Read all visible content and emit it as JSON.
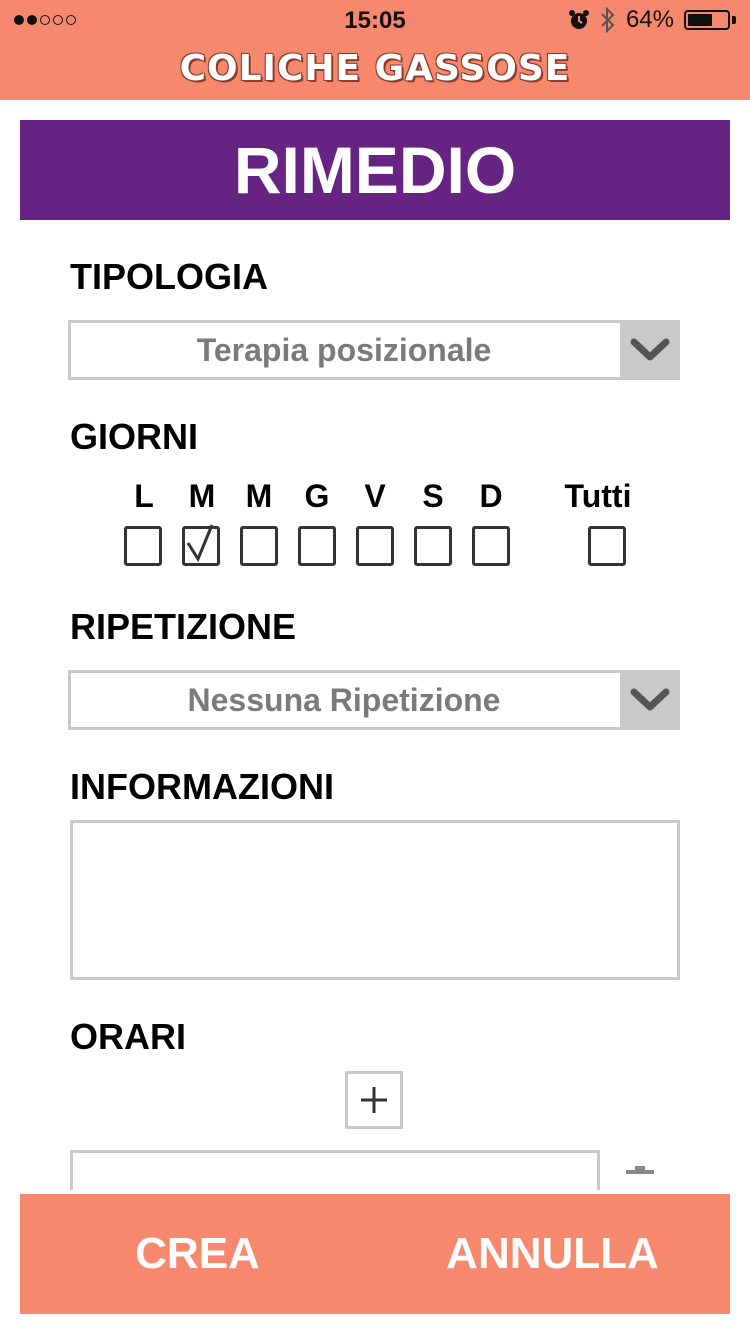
{
  "status_bar": {
    "time": "15:05",
    "battery_percent": "64%",
    "battery_level": 0.64,
    "signal_filled": 2,
    "signal_total": 5,
    "icons": [
      "alarm-icon",
      "bluetooth-icon",
      "battery-icon"
    ]
  },
  "app": {
    "title": "COLICHE GASSOSE",
    "header_color": "#f6886e"
  },
  "banner": {
    "title": "RIMEDIO",
    "color": "#672381"
  },
  "tipologia": {
    "label": "TIPOLOGIA",
    "selected": "Terapia posizionale"
  },
  "giorni": {
    "label": "GIORNI",
    "days": [
      {
        "letter": "L",
        "checked": false
      },
      {
        "letter": "M",
        "checked": true
      },
      {
        "letter": "M",
        "checked": false
      },
      {
        "letter": "G",
        "checked": false
      },
      {
        "letter": "V",
        "checked": false
      },
      {
        "letter": "S",
        "checked": false
      },
      {
        "letter": "D",
        "checked": false
      }
    ],
    "all_label": "Tutti",
    "all_checked": false
  },
  "ripetizione": {
    "label": "RIPETIZIONE",
    "selected": "Nessuna Ripetizione"
  },
  "informazioni": {
    "label": "INFORMAZIONI",
    "value": ""
  },
  "orari": {
    "label": "ORARI",
    "add_icon": "plus-icon",
    "delete_icon": "trash-icon"
  },
  "footer": {
    "create_label": "CREA",
    "cancel_label": "ANNULLA"
  }
}
